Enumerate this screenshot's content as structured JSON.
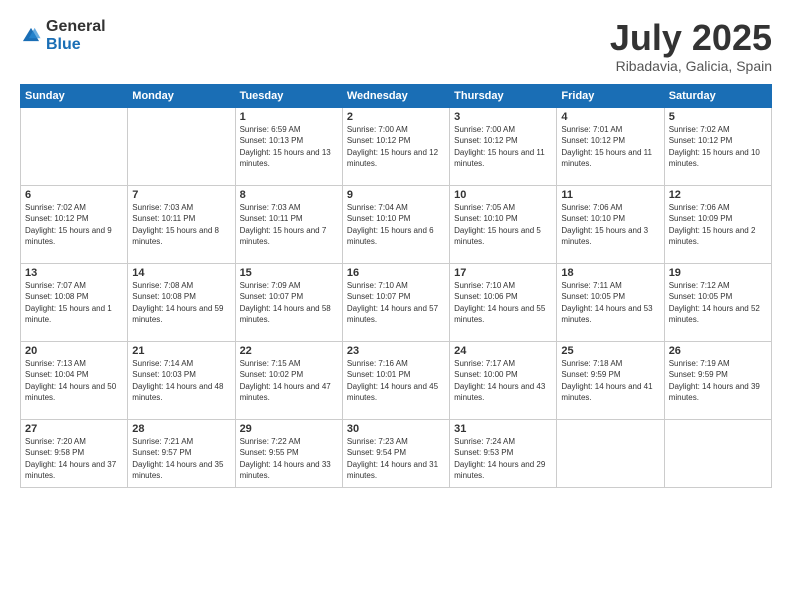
{
  "logo": {
    "general": "General",
    "blue": "Blue"
  },
  "title": "July 2025",
  "subtitle": "Ribadavia, Galicia, Spain",
  "headers": [
    "Sunday",
    "Monday",
    "Tuesday",
    "Wednesday",
    "Thursday",
    "Friday",
    "Saturday"
  ],
  "weeks": [
    [
      {
        "day": "",
        "sunrise": "",
        "sunset": "",
        "daylight": ""
      },
      {
        "day": "",
        "sunrise": "",
        "sunset": "",
        "daylight": ""
      },
      {
        "day": "1",
        "sunrise": "Sunrise: 6:59 AM",
        "sunset": "Sunset: 10:13 PM",
        "daylight": "Daylight: 15 hours and 13 minutes."
      },
      {
        "day": "2",
        "sunrise": "Sunrise: 7:00 AM",
        "sunset": "Sunset: 10:12 PM",
        "daylight": "Daylight: 15 hours and 12 minutes."
      },
      {
        "day": "3",
        "sunrise": "Sunrise: 7:00 AM",
        "sunset": "Sunset: 10:12 PM",
        "daylight": "Daylight: 15 hours and 11 minutes."
      },
      {
        "day": "4",
        "sunrise": "Sunrise: 7:01 AM",
        "sunset": "Sunset: 10:12 PM",
        "daylight": "Daylight: 15 hours and 11 minutes."
      },
      {
        "day": "5",
        "sunrise": "Sunrise: 7:02 AM",
        "sunset": "Sunset: 10:12 PM",
        "daylight": "Daylight: 15 hours and 10 minutes."
      }
    ],
    [
      {
        "day": "6",
        "sunrise": "Sunrise: 7:02 AM",
        "sunset": "Sunset: 10:12 PM",
        "daylight": "Daylight: 15 hours and 9 minutes."
      },
      {
        "day": "7",
        "sunrise": "Sunrise: 7:03 AM",
        "sunset": "Sunset: 10:11 PM",
        "daylight": "Daylight: 15 hours and 8 minutes."
      },
      {
        "day": "8",
        "sunrise": "Sunrise: 7:03 AM",
        "sunset": "Sunset: 10:11 PM",
        "daylight": "Daylight: 15 hours and 7 minutes."
      },
      {
        "day": "9",
        "sunrise": "Sunrise: 7:04 AM",
        "sunset": "Sunset: 10:10 PM",
        "daylight": "Daylight: 15 hours and 6 minutes."
      },
      {
        "day": "10",
        "sunrise": "Sunrise: 7:05 AM",
        "sunset": "Sunset: 10:10 PM",
        "daylight": "Daylight: 15 hours and 5 minutes."
      },
      {
        "day": "11",
        "sunrise": "Sunrise: 7:06 AM",
        "sunset": "Sunset: 10:10 PM",
        "daylight": "Daylight: 15 hours and 3 minutes."
      },
      {
        "day": "12",
        "sunrise": "Sunrise: 7:06 AM",
        "sunset": "Sunset: 10:09 PM",
        "daylight": "Daylight: 15 hours and 2 minutes."
      }
    ],
    [
      {
        "day": "13",
        "sunrise": "Sunrise: 7:07 AM",
        "sunset": "Sunset: 10:08 PM",
        "daylight": "Daylight: 15 hours and 1 minute."
      },
      {
        "day": "14",
        "sunrise": "Sunrise: 7:08 AM",
        "sunset": "Sunset: 10:08 PM",
        "daylight": "Daylight: 14 hours and 59 minutes."
      },
      {
        "day": "15",
        "sunrise": "Sunrise: 7:09 AM",
        "sunset": "Sunset: 10:07 PM",
        "daylight": "Daylight: 14 hours and 58 minutes."
      },
      {
        "day": "16",
        "sunrise": "Sunrise: 7:10 AM",
        "sunset": "Sunset: 10:07 PM",
        "daylight": "Daylight: 14 hours and 57 minutes."
      },
      {
        "day": "17",
        "sunrise": "Sunrise: 7:10 AM",
        "sunset": "Sunset: 10:06 PM",
        "daylight": "Daylight: 14 hours and 55 minutes."
      },
      {
        "day": "18",
        "sunrise": "Sunrise: 7:11 AM",
        "sunset": "Sunset: 10:05 PM",
        "daylight": "Daylight: 14 hours and 53 minutes."
      },
      {
        "day": "19",
        "sunrise": "Sunrise: 7:12 AM",
        "sunset": "Sunset: 10:05 PM",
        "daylight": "Daylight: 14 hours and 52 minutes."
      }
    ],
    [
      {
        "day": "20",
        "sunrise": "Sunrise: 7:13 AM",
        "sunset": "Sunset: 10:04 PM",
        "daylight": "Daylight: 14 hours and 50 minutes."
      },
      {
        "day": "21",
        "sunrise": "Sunrise: 7:14 AM",
        "sunset": "Sunset: 10:03 PM",
        "daylight": "Daylight: 14 hours and 48 minutes."
      },
      {
        "day": "22",
        "sunrise": "Sunrise: 7:15 AM",
        "sunset": "Sunset: 10:02 PM",
        "daylight": "Daylight: 14 hours and 47 minutes."
      },
      {
        "day": "23",
        "sunrise": "Sunrise: 7:16 AM",
        "sunset": "Sunset: 10:01 PM",
        "daylight": "Daylight: 14 hours and 45 minutes."
      },
      {
        "day": "24",
        "sunrise": "Sunrise: 7:17 AM",
        "sunset": "Sunset: 10:00 PM",
        "daylight": "Daylight: 14 hours and 43 minutes."
      },
      {
        "day": "25",
        "sunrise": "Sunrise: 7:18 AM",
        "sunset": "Sunset: 9:59 PM",
        "daylight": "Daylight: 14 hours and 41 minutes."
      },
      {
        "day": "26",
        "sunrise": "Sunrise: 7:19 AM",
        "sunset": "Sunset: 9:59 PM",
        "daylight": "Daylight: 14 hours and 39 minutes."
      }
    ],
    [
      {
        "day": "27",
        "sunrise": "Sunrise: 7:20 AM",
        "sunset": "Sunset: 9:58 PM",
        "daylight": "Daylight: 14 hours and 37 minutes."
      },
      {
        "day": "28",
        "sunrise": "Sunrise: 7:21 AM",
        "sunset": "Sunset: 9:57 PM",
        "daylight": "Daylight: 14 hours and 35 minutes."
      },
      {
        "day": "29",
        "sunrise": "Sunrise: 7:22 AM",
        "sunset": "Sunset: 9:55 PM",
        "daylight": "Daylight: 14 hours and 33 minutes."
      },
      {
        "day": "30",
        "sunrise": "Sunrise: 7:23 AM",
        "sunset": "Sunset: 9:54 PM",
        "daylight": "Daylight: 14 hours and 31 minutes."
      },
      {
        "day": "31",
        "sunrise": "Sunrise: 7:24 AM",
        "sunset": "Sunset: 9:53 PM",
        "daylight": "Daylight: 14 hours and 29 minutes."
      },
      {
        "day": "",
        "sunrise": "",
        "sunset": "",
        "daylight": ""
      },
      {
        "day": "",
        "sunrise": "",
        "sunset": "",
        "daylight": ""
      }
    ]
  ]
}
